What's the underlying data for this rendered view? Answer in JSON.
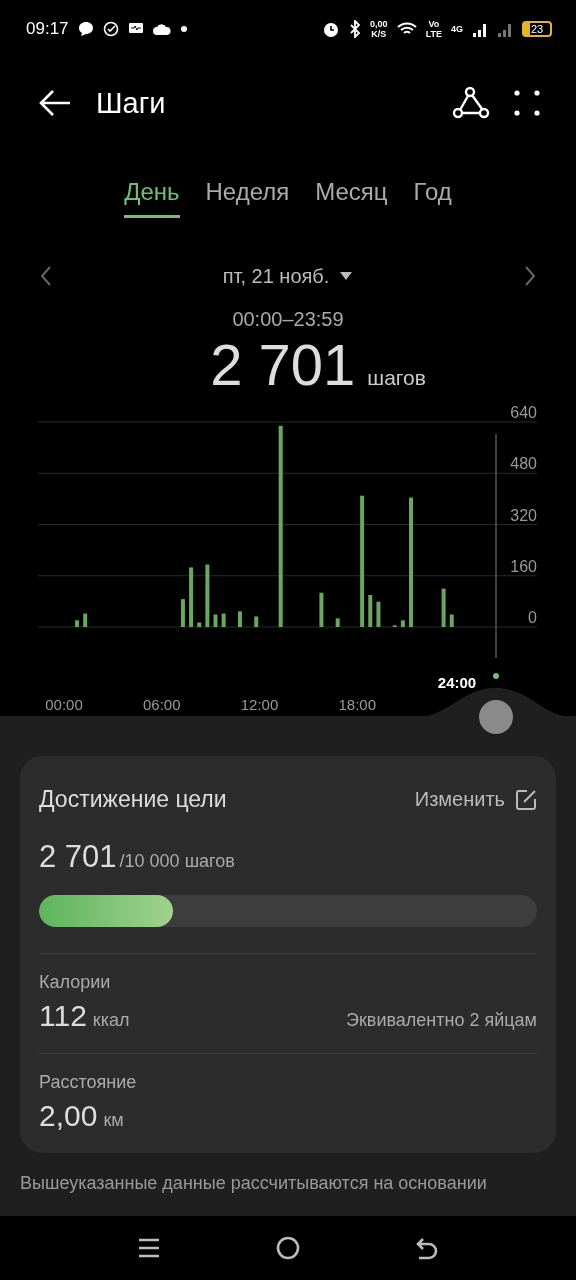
{
  "status_bar": {
    "time": "09:17",
    "net_speed": "0,00",
    "net_unit": "K/S",
    "volte_top": "Vo",
    "volte_bottom": "LTE",
    "network": "4G",
    "battery": "23"
  },
  "header": {
    "title": "Шаги"
  },
  "tabs": [
    {
      "label": "День",
      "selected": true
    },
    {
      "label": "Неделя",
      "selected": false
    },
    {
      "label": "Месяц",
      "selected": false
    },
    {
      "label": "Год",
      "selected": false
    }
  ],
  "date": {
    "label": "пт, 21 нояб.",
    "range": "00:00–23:59",
    "total": "2 701",
    "unit": "шагов"
  },
  "chart": {
    "cursor_label": "24:00",
    "chart_data": {
      "type": "bar",
      "x": [
        0.5,
        1,
        7,
        7.5,
        8,
        8.5,
        9,
        9.5,
        10.5,
        11.5,
        13,
        15.5,
        16.5,
        18,
        18.5,
        19,
        20,
        20.5,
        21,
        23,
        23.5
      ],
      "grid": true,
      "series": [
        {
          "color": "#6aa85f",
          "values": [
            21,
            42,
            87,
            186,
            14,
            195,
            39,
            42,
            49,
            33,
            628,
            107,
            27,
            410,
            100,
            79,
            5,
            21,
            404,
            120,
            39
          ]
        }
      ],
      "xlim": [
        0,
        24
      ],
      "ylim": [
        0,
        640
      ],
      "xticks": [
        {
          "value": 0,
          "label": "00:00"
        },
        {
          "value": 6,
          "label": "06:00"
        },
        {
          "value": 12,
          "label": "12:00"
        },
        {
          "value": 18,
          "label": "18:00"
        }
      ],
      "yticks": [
        0,
        160,
        320,
        480,
        640
      ]
    }
  },
  "goal": {
    "title": "Достижение цели",
    "edit": "Изменить",
    "steps": "2 701",
    "target": "/10 000 шагов",
    "level": 0.27
  },
  "stats": [
    {
      "label": "Калории",
      "value": "112",
      "unit": "ккал",
      "note": "Эквивалентно 2 яйцам"
    },
    {
      "label": "Расстояние",
      "value": "2,00",
      "unit": "км"
    }
  ],
  "footer": "Вышеуказанные данные рассчитываются на основании"
}
